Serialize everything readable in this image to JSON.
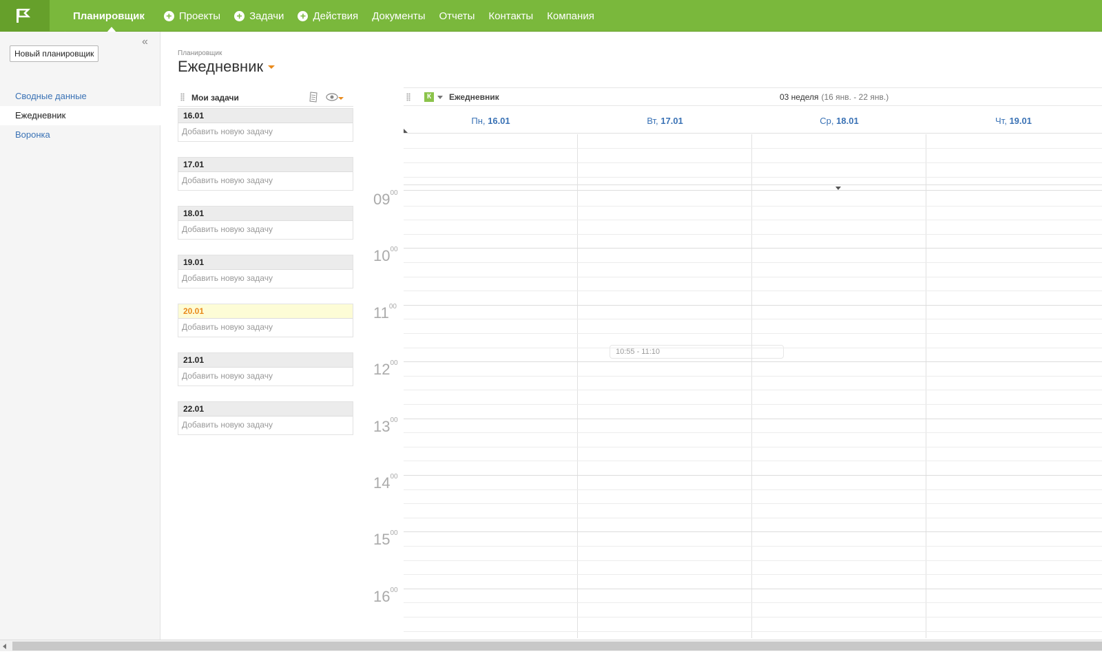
{
  "nav": {
    "items": [
      {
        "label": "Планировщик",
        "active": true,
        "plus": false
      },
      {
        "label": "Проекты",
        "plus": true
      },
      {
        "label": "Задачи",
        "plus": true
      },
      {
        "label": "Действия",
        "plus": true
      },
      {
        "label": "Документы",
        "plus": false
      },
      {
        "label": "Отчеты",
        "plus": false
      },
      {
        "label": "Контакты",
        "plus": false
      },
      {
        "label": "Компания",
        "plus": false
      }
    ]
  },
  "sidebar": {
    "collapse_glyph": "«",
    "new_button": "Новый планировщик",
    "items": [
      {
        "label": "Сводные данные",
        "active": false
      },
      {
        "label": "Ежедневник",
        "active": true
      },
      {
        "label": "Воронка",
        "active": false
      }
    ]
  },
  "page": {
    "breadcrumb": "Планировщик",
    "title": "Ежедневник"
  },
  "tasks": {
    "title": "Мои задачи",
    "add_placeholder": "Добавить новую задачу",
    "days": [
      {
        "date": "16.01",
        "today": false
      },
      {
        "date": "17.01",
        "today": false
      },
      {
        "date": "18.01",
        "today": false
      },
      {
        "date": "19.01",
        "today": false
      },
      {
        "date": "20.01",
        "today": true
      },
      {
        "date": "21.01",
        "today": false
      },
      {
        "date": "22.01",
        "today": false
      }
    ]
  },
  "calendar": {
    "badge": "К",
    "name": "Ежедневник",
    "week": "03 неделя",
    "week_range": "(16 янв. - 22 янв.)",
    "days": [
      {
        "dow": "Пн,",
        "date": "16.01"
      },
      {
        "dow": "Вт,",
        "date": "17.01"
      },
      {
        "dow": "Ср,",
        "date": "18.01"
      },
      {
        "dow": "Чт,",
        "date": "19.01"
      }
    ],
    "hours": [
      "09",
      "10",
      "11",
      "12",
      "13",
      "14",
      "15",
      "16"
    ],
    "minutes": "00",
    "event": {
      "time": "10:55 - 11:10",
      "day": "Вт, 17.01"
    }
  },
  "colors": {
    "topbar": "#7ab83c",
    "accent": "#e98a1c",
    "link": "#3a72b5"
  }
}
